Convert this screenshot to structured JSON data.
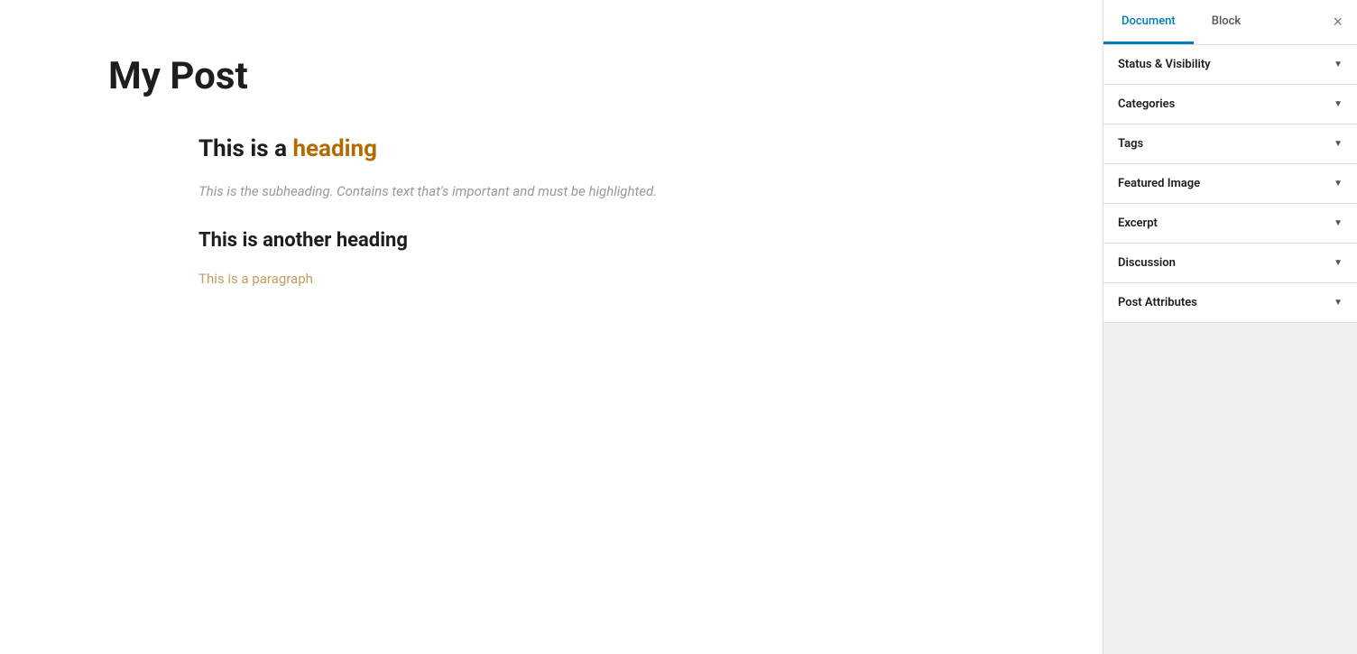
{
  "main": {
    "post_title": "My Post",
    "heading1_before": "This is a ",
    "heading1_highlight": "heading",
    "subheading": "This is the subheading. Contains text that's important and must be highlighted.",
    "heading2": "This is another heading",
    "paragraph_link": "This is a paragraph"
  },
  "sidebar": {
    "tab_document": "Document",
    "tab_block": "Block",
    "close_label": "×",
    "sections": [
      {
        "label": "Status & Visibility"
      },
      {
        "label": "Categories"
      },
      {
        "label": "Tags"
      },
      {
        "label": "Featured Image"
      },
      {
        "label": "Excerpt"
      },
      {
        "label": "Discussion"
      },
      {
        "label": "Post Attributes"
      }
    ]
  }
}
